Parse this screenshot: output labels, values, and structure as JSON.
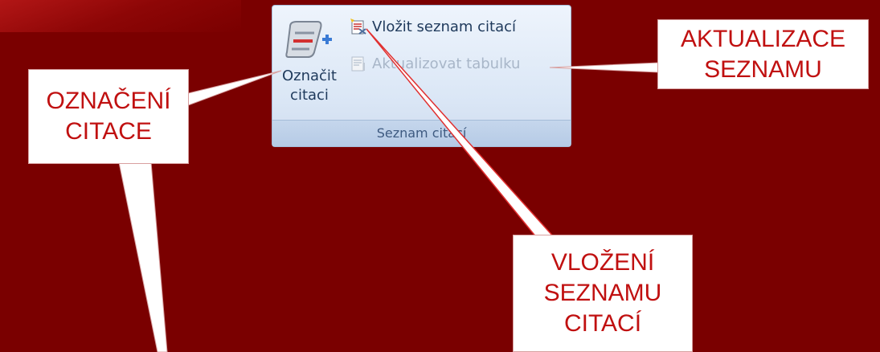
{
  "ribbon": {
    "mark_citation_button": {
      "line1": "Označit",
      "line2": "citaci",
      "icon": "mark-citation-icon"
    },
    "insert_table_button": {
      "label": "Vložit seznam citací",
      "icon": "insert-table-of-authorities-icon"
    },
    "update_table_button": {
      "label": "Aktualizovat tabulku",
      "icon": "update-table-icon",
      "disabled": true
    },
    "group_label": "Seznam citací"
  },
  "callouts": {
    "mark_citation": {
      "line1": "OZNAČENÍ",
      "line2": "CITACE"
    },
    "update_list": {
      "line1": "AKTUALIZACE",
      "line2": "SEZNAMU"
    },
    "insert_list": {
      "line1": "VLOŽENÍ",
      "line2": "SEZNAMU",
      "line3": "CITACÍ"
    }
  },
  "colors": {
    "background": "#7a0000",
    "callout_text": "#c01010",
    "callout_fill": "#ffffff",
    "ribbon_text": "#1e395b"
  }
}
